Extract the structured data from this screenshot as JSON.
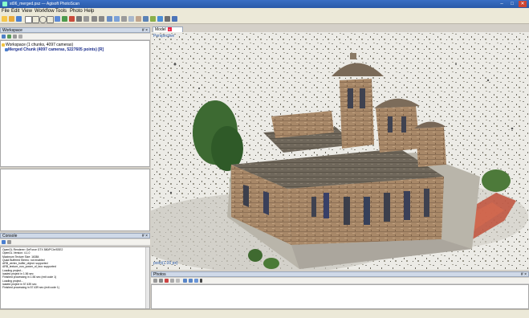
{
  "window": {
    "title": "st06_merged.psz — Agisoft PhotoScan"
  },
  "menu": [
    "File",
    "Edit",
    "View",
    "Workflow",
    "Tools",
    "Photo",
    "Help"
  ],
  "workspace": {
    "title": "Workspace",
    "controls": "# ×",
    "root": "Workspace (1 chunks, 4097 cameras)",
    "chunk": "Merged Chunk (4097 cameras, 5227605 points) [R]"
  },
  "model": {
    "tab_label": "Model",
    "tab_close": "×",
    "view_mode": "Perspective",
    "point_size": "point(1.00 px)"
  },
  "console": {
    "title": "Console",
    "controls": "# ×",
    "lines": [
      "OpenGL Renderer: GeForce GTX 580/PCIe/SSE2",
      "OpenGL Version: 4.1.0",
      "Maximum Texture Size: 16384",
      "Quad Buffered Stereo: not enabled",
      "ARB_vertex_buffer_object: supported",
      "ARB_texture_non_power_of_two: supported",
      "Loading project...",
      "loaded project in 1.56 sec",
      "Finished processing in 1.56 sec (exit code 1)",
      "Loading project...",
      "loaded project in 57.439 sec",
      "Finished processing in 57.439 sec (exit code 1)"
    ]
  },
  "photos": {
    "title": "Photos",
    "controls": "# ×"
  },
  "colors": {
    "accent": "#2a5aa8",
    "panel": "#ece9d8",
    "chunk_text": "#1a2d8c"
  }
}
